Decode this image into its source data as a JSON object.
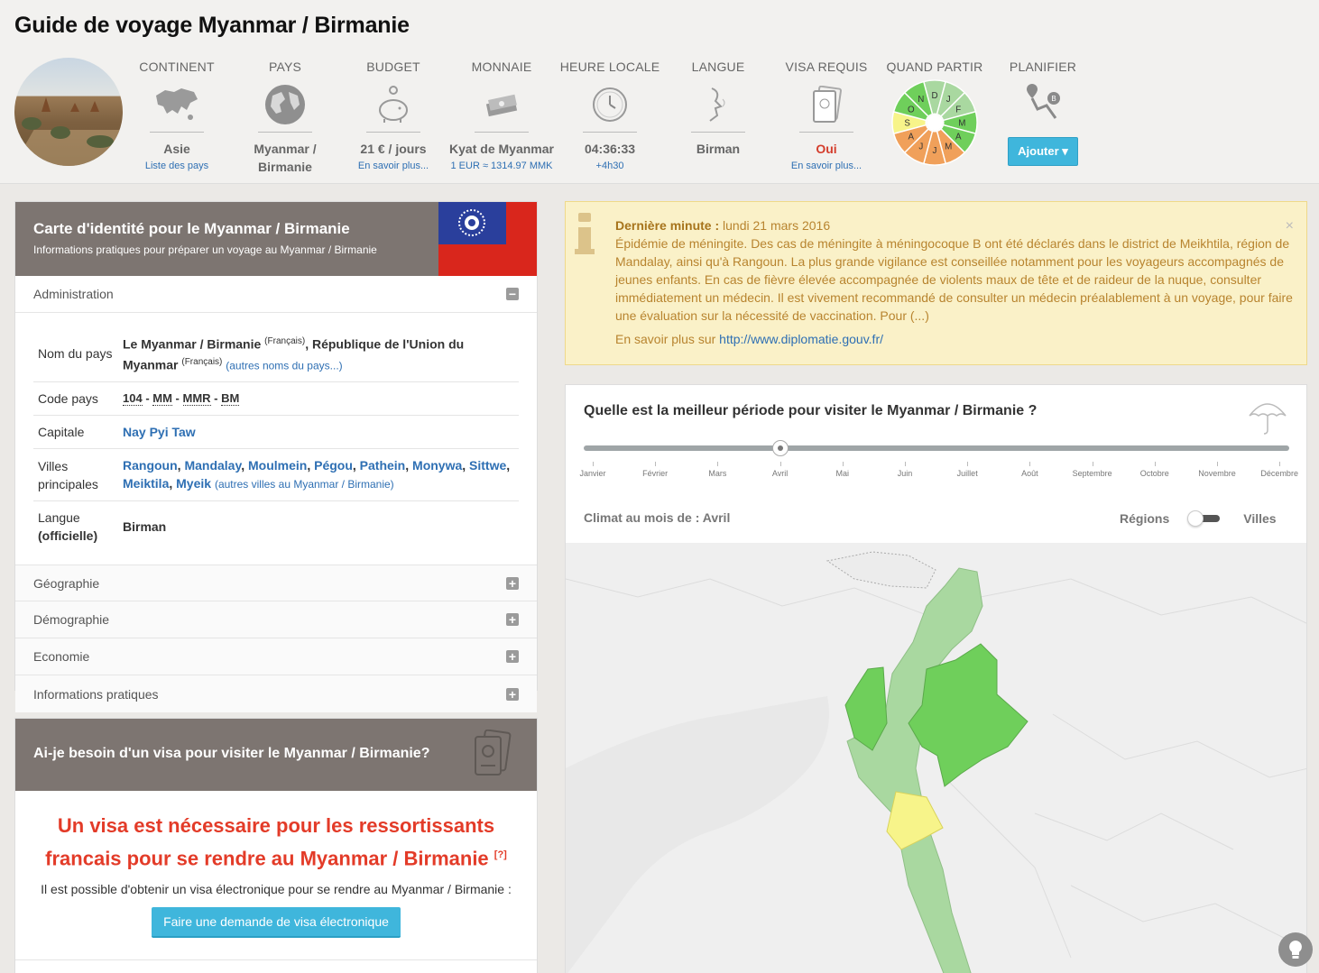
{
  "page": {
    "title": "Guide de voyage Myanmar / Birmanie"
  },
  "header": {
    "continent": {
      "label": "CONTINENT",
      "value": "Asie",
      "sub": "Liste des pays"
    },
    "pays": {
      "label": "PAYS",
      "value": "Myanmar /",
      "value2": "Birmanie"
    },
    "budget": {
      "label": "BUDGET",
      "value": "21 € / jours",
      "sub": "En savoir plus..."
    },
    "monnaie": {
      "label": "MONNAIE",
      "value": "Kyat de Myanmar",
      "sub": "1 EUR ≈ 1314.97 MMK"
    },
    "heure": {
      "label": "HEURE LOCALE",
      "value": "04:36:33",
      "sub": "+4h30"
    },
    "langue": {
      "label": "LANGUE",
      "value": "Birman"
    },
    "visa": {
      "label": "VISA REQUIS",
      "value": "Oui",
      "sub": "En savoir plus..."
    },
    "quand": {
      "label": "QUAND PARTIR",
      "months": [
        "D",
        "J",
        "F",
        "M",
        "A",
        "M",
        "J",
        "J",
        "A",
        "S",
        "O",
        "N"
      ]
    },
    "planifier": {
      "label": "PLANIFIER",
      "button": "Ajouter ▾"
    }
  },
  "identity": {
    "title": "Carte d'identité pour le Myanmar / Birmanie",
    "subtitle": "Informations pratiques pour préparer un voyage au Myanmar / Birmanie",
    "admin_label": "Administration",
    "rows": {
      "nom_k": "Nom du pays",
      "nom_v1": "Le Myanmar / Birmanie",
      "nom_sup1": "(Français)",
      "nom_mid": ", ",
      "nom_v2": "République de l'Union du Myanmar",
      "nom_sup2": "(Français)",
      "nom_link": "(autres noms du pays...)",
      "code_k": "Code pays",
      "code_1": "104",
      "code_2": "MM",
      "code_3": "MMR",
      "code_4": "BM",
      "cap_k": "Capitale",
      "cap_v": "Nay Pyi Taw",
      "villes_k": "Villes principales",
      "villes": [
        "Rangoun",
        "Mandalay",
        "Moulmein",
        "Pégou",
        "Pathein",
        "Monywa",
        "Sittwe",
        "Meiktila",
        "Myeik"
      ],
      "villes_link": "(autres villes au Myanmar / Birmanie)",
      "langue_k1": "Langue",
      "langue_k2": "(officielle)",
      "langue_v": "Birman"
    },
    "sections": [
      "Géographie",
      "Démographie",
      "Economie",
      "Informations pratiques"
    ]
  },
  "visa_card": {
    "title": "Ai-je besoin d'un visa pour visiter le Myanmar / Birmanie?",
    "big1": "Un visa est nécessaire pour les ressortissants",
    "big2": "francais pour se rendre au Myanmar / Birmanie",
    "ref": "[?]",
    "text": "Il est possible d'obtenir un visa électronique pour se rendre au Myanmar / Birmanie :",
    "button": "Faire une demande de visa électronique"
  },
  "alert": {
    "label": "Dernière minute :",
    "date": " lundi 21 mars 2016",
    "body": "Épidémie de méningite. Des cas de méningite à méningocoque B ont été déclarés dans le district de Meikhtila, région de Mandalay, ainsi qu'à Rangoun. La plus grande vigilance est conseillée notamment pour les voyageurs accompagnés de jeunes enfants. En cas de fièvre élevée accompagnée de violents maux de tête et de raideur de la nuque, consulter immédiatement un médecin. Il est vivement recommandé de consulter un médecin préalablement à un voyage, pour faire une évaluation sur la nécessité de vaccination. Pour (...)",
    "more_label": "En savoir plus sur ",
    "more_link": "http://www.diplomatie.gouv.fr/",
    "close": "×"
  },
  "climate": {
    "question": "Quelle est la meilleur période pour visiter le Myanmar / Birmanie ?",
    "months": [
      "Janvier",
      "Février",
      "Mars",
      "Avril",
      "Mai",
      "Juin",
      "Juillet",
      "Août",
      "Septembre",
      "Octobre",
      "Novembre",
      "Décembre"
    ],
    "selected_month_index": 3,
    "climat_label": "Climat au mois de : Avril",
    "toggle_left": "Régions",
    "toggle_right": "Villes"
  },
  "colors": {
    "green": "#6fcf5b",
    "light_green": "#a9d8a0",
    "yellow": "#f7f48a",
    "orange": "#f0a05a",
    "accent": "#3fb6dc",
    "red": "#e33b28"
  }
}
